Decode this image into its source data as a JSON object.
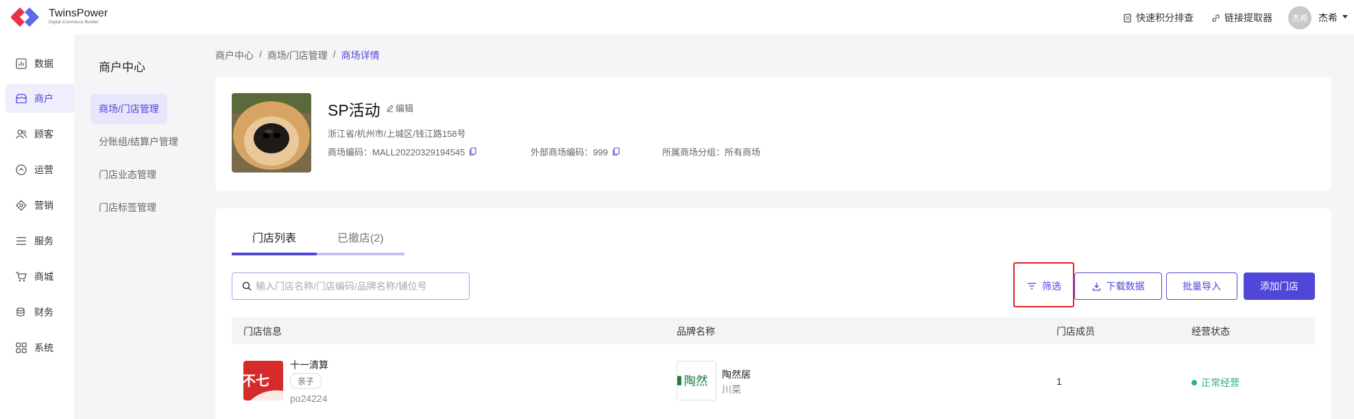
{
  "header": {
    "brand_name": "TwinsPower",
    "brand_sub": "Digital Commerce Builder",
    "actions": [
      {
        "label": "快速积分排查",
        "icon": "document-icon"
      },
      {
        "label": "链接提取器",
        "icon": "link-icon"
      }
    ],
    "user": {
      "avatar_text": "杰希",
      "name": "杰希"
    }
  },
  "leftnav": {
    "items": [
      {
        "label": "数据",
        "icon": "chart-icon"
      },
      {
        "label": "商户",
        "icon": "store-icon",
        "active": true
      },
      {
        "label": "顾客",
        "icon": "users-icon"
      },
      {
        "label": "运营",
        "icon": "operation-icon"
      },
      {
        "label": "营销",
        "icon": "marketing-icon"
      },
      {
        "label": "服务",
        "icon": "service-icon"
      },
      {
        "label": "商城",
        "icon": "cart-icon"
      },
      {
        "label": "财务",
        "icon": "finance-icon"
      },
      {
        "label": "系统",
        "icon": "grid-icon"
      }
    ]
  },
  "subnav": {
    "title": "商户中心",
    "items": [
      {
        "label": "商场/门店管理",
        "active": true
      },
      {
        "label": "分账组/结算户管理"
      },
      {
        "label": "门店业态管理"
      },
      {
        "label": "门店标签管理"
      }
    ]
  },
  "breadcrumb": [
    "商户中心",
    "商场/门店管理",
    "商场详情"
  ],
  "mall": {
    "name": "SP活动",
    "edit_label": "编辑",
    "address": "浙江省/杭州市/上城区/钱江路158号",
    "code_label": "商场编码：MALL20220329194545",
    "external_code_label": "外部商场编码：999",
    "group_label": "所属商场分组：所有商场"
  },
  "tabs": [
    {
      "label": "门店列表",
      "active": true
    },
    {
      "label": "已撤店(2)"
    }
  ],
  "toolbar": {
    "search_placeholder": "输入门店名称/门店编码/品牌名称/铺位号",
    "filter_label": "筛选",
    "download_label": "下载数据",
    "import_label": "批量导入",
    "add_label": "添加门店"
  },
  "table": {
    "columns": [
      "门店信息",
      "品牌名称",
      "门店成员",
      "经营状态"
    ],
    "rows": [
      {
        "store_name": "十一清算",
        "store_tag": "亲子",
        "store_code": "po24224",
        "logo_text": "不七",
        "brand_name": "陶然居",
        "brand_category": "川菜",
        "brand_logo_text": "陶然",
        "members": "1",
        "status": "正常经营"
      }
    ]
  },
  "colors": {
    "accent": "#5046d8",
    "status_ok": "#2db07a",
    "highlight": "#e02020"
  }
}
